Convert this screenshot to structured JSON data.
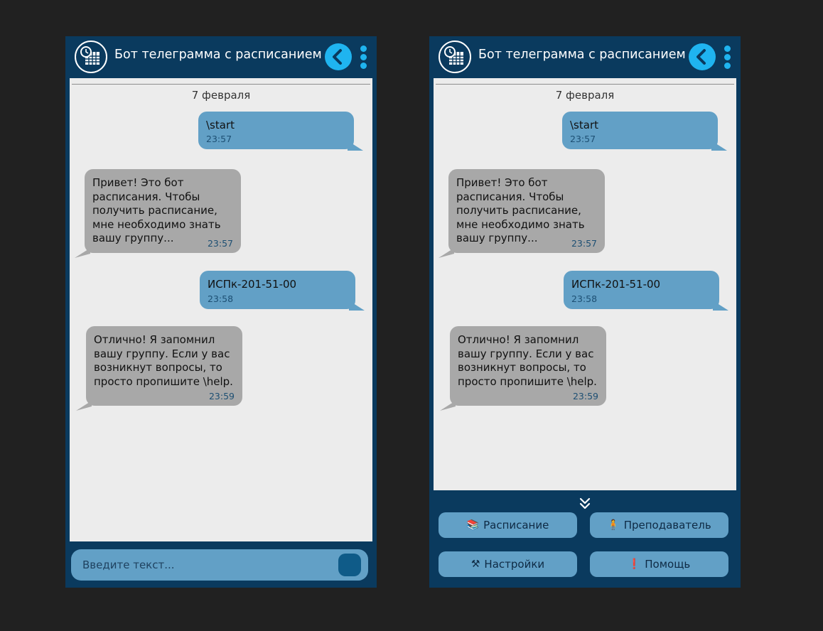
{
  "app": {
    "title": "Бот телеграмма с расписанием"
  },
  "chat": {
    "date": "7 февраля",
    "messages": [
      {
        "direction": "out",
        "text": "\\start",
        "time": "23:57"
      },
      {
        "direction": "in",
        "text": "Привет! Это бот\nрасписания. Чтобы\nполучить расписание,\nмне необходимо знать\nвашу группу...",
        "time": "23:57"
      },
      {
        "direction": "out",
        "text": "ИСПк-201-51-00",
        "time": "23:58"
      },
      {
        "direction": "in",
        "text": "Отлично! Я запомнил\nвашу группу. Если у вас\nвозникнут вопросы, то\nпросто пропишите \\help.",
        "time": "23:59"
      }
    ]
  },
  "composer": {
    "placeholder": "Введите текст..."
  },
  "keyboard": {
    "buttons": [
      {
        "label": "Расписание",
        "icon": "books-emoji",
        "glyph": "📚"
      },
      {
        "label": "Преподаватель",
        "icon": "person-emoji",
        "glyph": "🧍"
      },
      {
        "label": "Настройки",
        "icon": "tools-emoji",
        "glyph": "⚒"
      },
      {
        "label": "Помощь",
        "icon": "exclamation-emoji",
        "glyph": "❗"
      }
    ]
  },
  "colors": {
    "background": "#212121",
    "panel": "#0a3a5e",
    "accent": "#1fb4f0",
    "chat_bg": "#ececec",
    "bubble_out": "#62a0c6",
    "bubble_in": "#a8a8a8"
  }
}
